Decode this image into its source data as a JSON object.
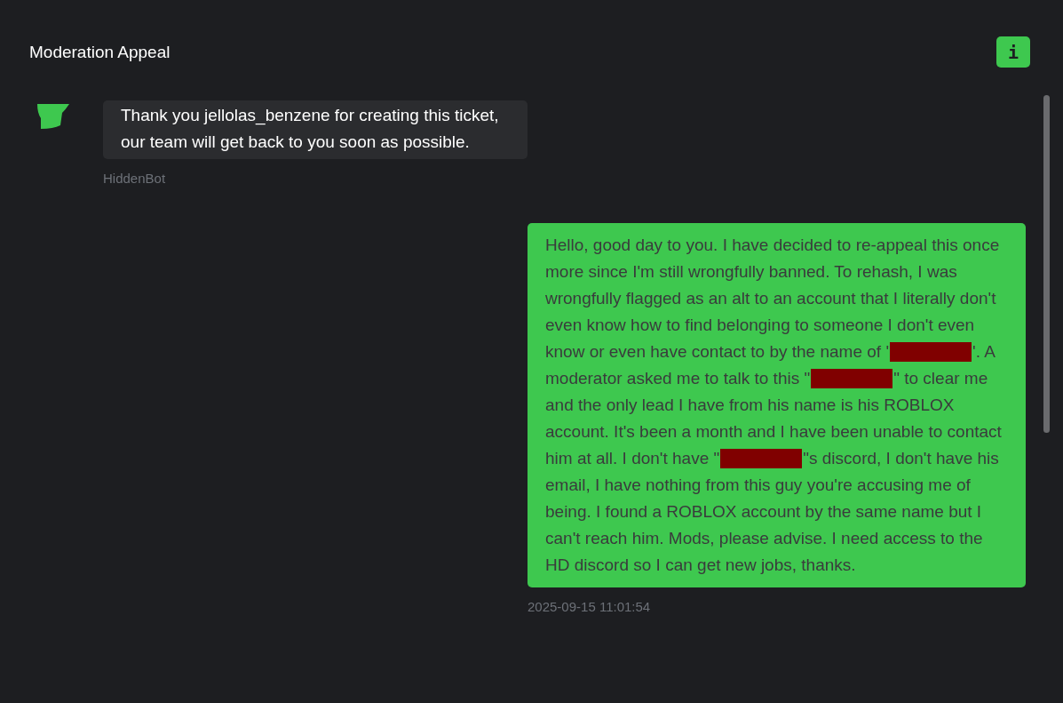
{
  "header": {
    "title": "Moderation Appeal",
    "info_button": "i"
  },
  "messages": [
    {
      "kind": "bot",
      "segments": [
        {
          "kind": "text",
          "text": "Thank you jellolas_benzene for creating this ticket,\nour team will get back to you soon as possible."
        }
      ],
      "meta": "HiddenBot"
    },
    {
      "kind": "user",
      "segments": [
        {
          "kind": "text",
          "text": "Hello, good day to you. I have decided to re-appeal this once more since I'm still wrongfully banned. To rehash, I was wrongfully flagged as an alt to an account that I literally don't even know how to find belonging to someone I don't even know or even have contact to by the name of '"
        },
        {
          "kind": "redacted"
        },
        {
          "kind": "text",
          "text": "'. A moderator asked me to talk to this \""
        },
        {
          "kind": "redacted"
        },
        {
          "kind": "text",
          "text": "\" to clear me and the only lead I have from his name is his ROBLOX account. It's been a month and I have been unable to contact him at all. I don't have \""
        },
        {
          "kind": "redacted"
        },
        {
          "kind": "text",
          "text": "\"s discord, I don't have his email, I have nothing from this guy you're accusing me of being. I found a ROBLOX account by the same name but I can't reach him. Mods, please advise. I need access to the HD discord so I can get new jobs, thanks."
        }
      ],
      "meta": "2025-09-15 11:01:54"
    }
  ]
}
